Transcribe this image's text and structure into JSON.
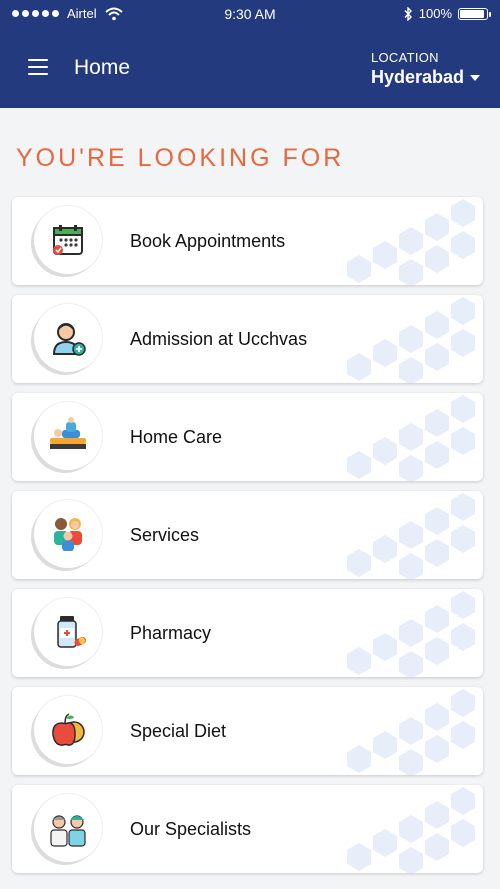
{
  "status_bar": {
    "carrier": "Airtel",
    "time": "9:30 AM",
    "battery": "100%",
    "battery_level": 1.0
  },
  "header": {
    "title": "Home",
    "location_label": "LOCATION",
    "location_value": "Hyderabad"
  },
  "section_title": "YOU'RE LOOKING FOR",
  "items": [
    {
      "label": "Book Appointments",
      "icon": "calendar-icon"
    },
    {
      "label": "Admission at Ucchvas",
      "icon": "patient-admission-icon"
    },
    {
      "label": "Home Care",
      "icon": "home-care-bed-icon"
    },
    {
      "label": "Services",
      "icon": "family-icon"
    },
    {
      "label": "Pharmacy",
      "icon": "medicine-bottle-icon"
    },
    {
      "label": "Special Diet",
      "icon": "fruit-icon"
    },
    {
      "label": "Our Specialists",
      "icon": "doctors-icon"
    }
  ],
  "colors": {
    "header_bg": "#233a7e",
    "accent": "#e8683e",
    "hex_pattern": "#e8eef9"
  }
}
